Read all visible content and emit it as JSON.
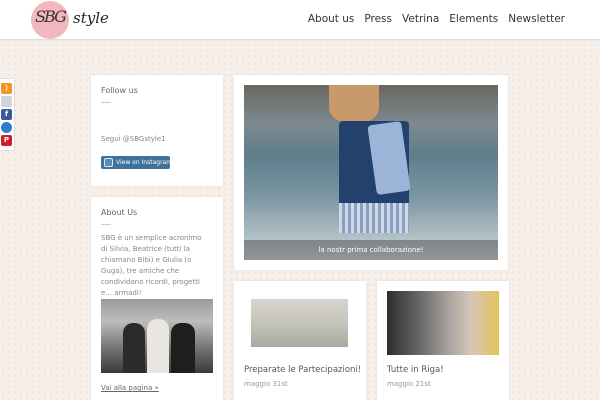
{
  "brand": {
    "monogram": "SBG",
    "wordmark": "style"
  },
  "nav": {
    "items": [
      "About us",
      "Press",
      "Vetrina",
      "Elements",
      "Newsletter"
    ]
  },
  "social": {
    "icons": [
      "rss-icon",
      "mail-icon",
      "facebook-icon",
      "web-icon",
      "pinterest-icon"
    ]
  },
  "sidebar": {
    "follow": {
      "title": "Follow us",
      "handle": "Segui @SBGstyle1",
      "instagram_button": "View on Instagram"
    },
    "about": {
      "title": "About Us",
      "text": "SBG è un semplice acronimo di Silvia, Beatrice (tutti la chiamano Bibi) e Giulia (o Guga), tre amiche che condividono ricordi, progetti e... armadi!",
      "link": "Vai alla pagina »"
    }
  },
  "featured": {
    "caption": "la nostr prima collaborazione!"
  },
  "posts": [
    {
      "title": "Preparate le Partecipazioni!",
      "date": "maggio 31st"
    },
    {
      "title": "Tutte in Riga!",
      "date": "maggio 21st"
    }
  ]
}
